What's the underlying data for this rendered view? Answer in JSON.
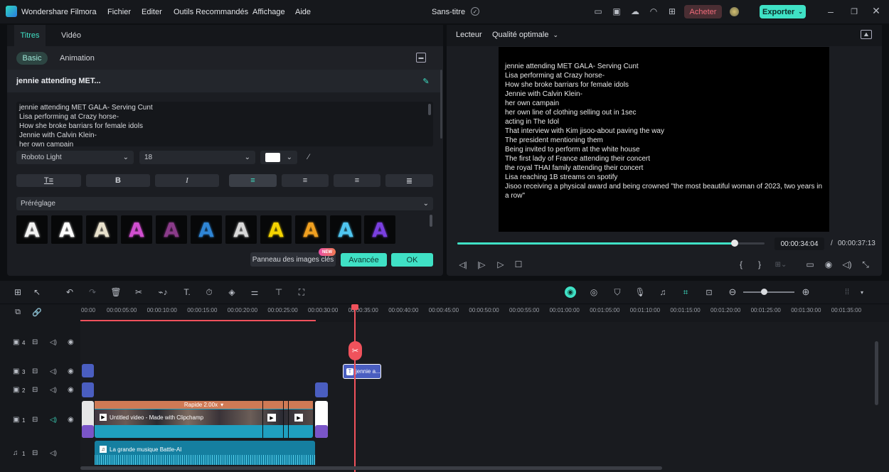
{
  "app": {
    "name": "Wondershare Filmora",
    "project": "Sans-titre"
  },
  "menu": [
    "Fichier",
    "Editer",
    "Outils Recommandés",
    "Affichage",
    "Aide"
  ],
  "header": {
    "buy": "Acheter",
    "export": "Exporter"
  },
  "editor": {
    "tabs": [
      "Titres",
      "Vidéo"
    ],
    "subtabs": [
      "Basic",
      "Animation"
    ],
    "title_name": "jennie attending MET...",
    "text_lines": [
      "jennie attending MET GALA- Serving Cunt",
      "Lisa performing at Crazy horse-",
      "How she broke barriars for female idols",
      "Jennie with Calvin Klein-",
      "her own campain"
    ],
    "font": "Roboto Light",
    "size": "18",
    "color": "#ffffff",
    "preset_label": "Préréglage",
    "presets": [
      {
        "color": "#f2f2f2"
      },
      {
        "color": "#ffffff"
      },
      {
        "color": "#e8e1cc"
      },
      {
        "color": "#d14fd0"
      },
      {
        "color": "#8b3b8a"
      },
      {
        "color": "#2f86d6"
      },
      {
        "color": "#d8d8d8"
      },
      {
        "color": "#f5d400"
      },
      {
        "color": "#f0a020"
      },
      {
        "color": "#4fc6f0"
      },
      {
        "color": "#7a3fe0"
      }
    ],
    "buttons": {
      "panneau": "Panneau des images clés",
      "new_badge": "NEW",
      "advanced": "Avancée",
      "ok": "OK"
    }
  },
  "player": {
    "label": "Lecteur",
    "quality": "Qualité optimale",
    "lines": [
      "jennie attending MET GALA- Serving Cunt",
      "Lisa performing at Crazy horse-",
      "How she broke barriars for female idols",
      "Jennie with Calvin Klein-",
      "her own campain",
      "her own line of clothing selling out in 1sec",
      "acting in The Idol",
      "That interview with Kim jisoo-about paving the way",
      "The president mentioning them",
      "Being invited to perform at the white house",
      "The  first lady of France attending their concert",
      "the royal THAI family attending their concert",
      "Lisa reaching 1B streams on spotify",
      "Jisoo receiving a physical award and being crowned \"the most beautiful woman of 2023, two years in a row\""
    ],
    "current_time": "00:00:34:04",
    "total_time": "00:00:37:13",
    "progress": 0.91
  },
  "timeline": {
    "ruler": [
      "00:00",
      "00:00:05:00",
      "00:00:10:00",
      "00:00:15:00",
      "00:00:20:00",
      "00:00:25:00",
      "00:00:30:00",
      "00:00:35:00",
      "00:00:40:00",
      "00:00:45:00",
      "00:00:50:00",
      "00:00:55:00",
      "00:01:00:00",
      "00:01:05:00",
      "00:01:10:00",
      "00:01:15:00",
      "00:01:20:00",
      "00:01:25:00",
      "00:01:30:00",
      "00:01:35:00"
    ],
    "tracks": [
      "4",
      "3",
      "2",
      "1",
      "1"
    ],
    "title_clip": "jennie a...",
    "speed_label": "Rapide 2.00x",
    "video_clip": "Untitled video - Made with Clipchamp",
    "audio_clip": "La grande musique Battle-AI"
  }
}
